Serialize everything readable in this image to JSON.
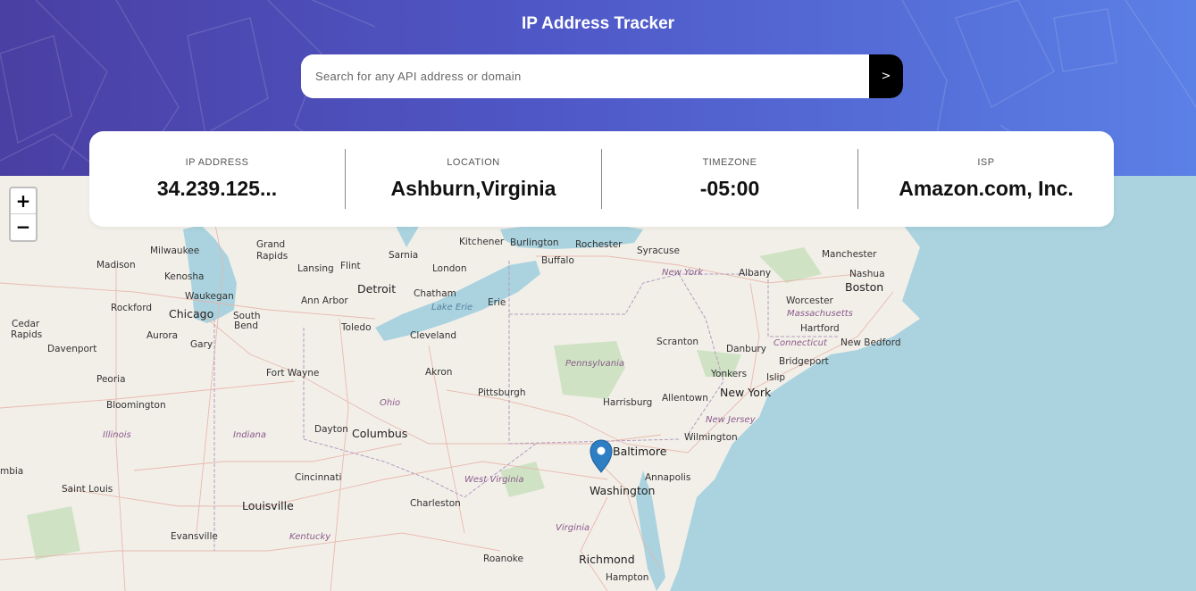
{
  "header": {
    "title": "IP Address Tracker",
    "search_placeholder": "Search for any API address or domain",
    "search_value": "",
    "submit_label": ">"
  },
  "info": [
    {
      "label": "IP ADDRESS",
      "value": "34.239.125..."
    },
    {
      "label": "LOCATION",
      "value": "Ashburn,Virginia"
    },
    {
      "label": "TIMEZONE",
      "value": "-05:00"
    },
    {
      "label": "ISP",
      "value": "Amazon.com, Inc."
    }
  ],
  "map": {
    "zoom_in": "+",
    "zoom_out": "−",
    "marker": "map-pin-icon",
    "cities": [
      "Milwaukee",
      "Madison",
      "Grand Rapids",
      "Lansing",
      "Flint",
      "Kenosha",
      "Waukegan",
      "Rockford",
      "Chicago",
      "South Bend",
      "Cedar Rapids",
      "Davenport",
      "Aurora",
      "Gary",
      "Detroit",
      "Ann Arbor",
      "Toledo",
      "Chatham",
      "Kitchener",
      "Burlington",
      "London",
      "Sarnia",
      "Rochester",
      "Buffalo",
      "Syracuse",
      "Albany",
      "Manchester",
      "Nashua",
      "Boston",
      "Worcester",
      "Hartford",
      "New Bedford",
      "Erie",
      "Cleveland",
      "Akron",
      "Fort Wayne",
      "Peoria",
      "Bloomington",
      "Dayton",
      "Columbus",
      "Pittsburgh",
      "Scranton",
      "Danbury",
      "Yonkers",
      "Bridgeport",
      "Islip",
      "New York",
      "Allentown",
      "Harrisburg",
      "Wilmington",
      "Baltimore",
      "Annapolis",
      "Washington",
      "Cincinnati",
      "Charleston",
      "Louisville",
      "Saint Louis",
      "Evansville",
      "Roanoke",
      "Richmond",
      "Hampton",
      "mbia"
    ],
    "states": [
      "Pennsylvania",
      "New York",
      "Massachusetts",
      "Connecticut",
      "Ohio",
      "Indiana",
      "Illinois",
      "New Jersey",
      "West Virginia",
      "Kentucky",
      "Virginia"
    ],
    "water": [
      "Lake Erie"
    ]
  }
}
